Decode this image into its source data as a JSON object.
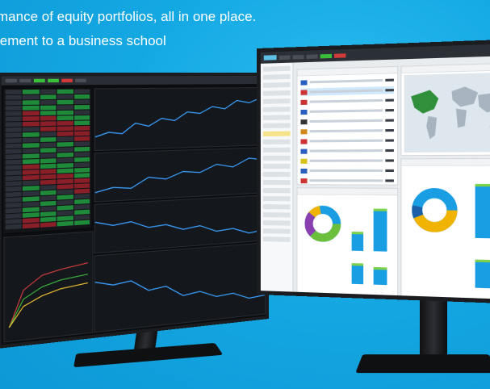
{
  "headline": {
    "line1": "mance of equity portfolios, all in one place.",
    "line2": "lement to a business school"
  },
  "colors": {
    "background": "#12a7e2",
    "headline_text": "#ffffff",
    "monitor_bezel": "#1a1c20",
    "chart_line": "#3aa0ff",
    "donut_segments": [
      "#f0b400",
      "#1a9ee3",
      "#6bbf3b",
      "#8a3fb0"
    ],
    "bar_fill": "#1a9ee3",
    "bar_top": "#7dd14b"
  },
  "screens": {
    "left": {
      "label": "trading terminal dashboard"
    },
    "right": {
      "label": "portfolio exposure dashboard"
    }
  },
  "icons": {
    "world_map": "world-map-icon",
    "country_flags": "flag-icon"
  }
}
